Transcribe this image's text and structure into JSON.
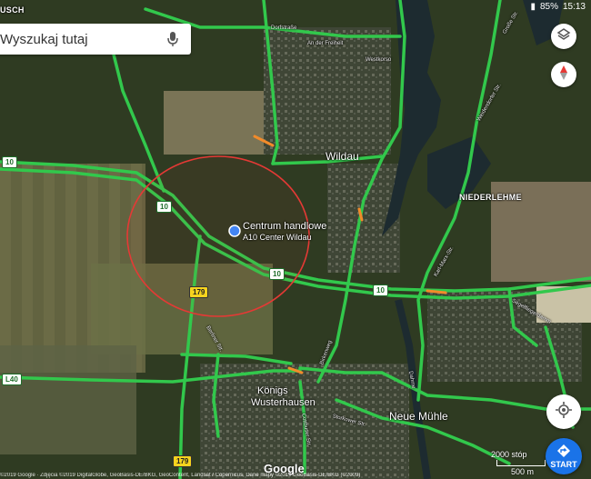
{
  "status": {
    "battery": "85%",
    "time": "15:13"
  },
  "search": {
    "placeholder": "Wyszukaj tutaj"
  },
  "corner_label": "USCH",
  "poi": {
    "name": "Centrum handlowe",
    "sub": "A10 Center Wildau"
  },
  "towns": {
    "wildau": "Wildau",
    "niederlehme": "NIEDERLEHME",
    "konigs1": "Königs",
    "konigs2": "Wusterhausen",
    "neue_muhle": "Neue Mühle"
  },
  "streets": [
    "Dorfstraße",
    "An der Freiheit",
    "Westkorso",
    "Berliner Str.",
    "Birkenweg",
    "Storkower Str.",
    "Cottbuser Str.",
    "Segelfliegerdamm",
    "Karl-Marx-Str.",
    "Dahme",
    "Weidendorfer Str.",
    "Große Str."
  ],
  "shields": {
    "a10_1": "10",
    "a10_2": "10",
    "a10_3": "10",
    "a10_4": "10",
    "b179_1": "179",
    "b179_2": "179",
    "l40": "L40"
  },
  "controls": {
    "start": "START"
  },
  "scale": {
    "ft": "2000 stóp",
    "m": "500 m"
  },
  "attribution": {
    "logo": "Google",
    "copyright": "©2019 Google · Zdjęcia ©2019 DigitalGlobe, GeoBasis-DE/BKG, GeoContent, Landsat / Copernicus, Dane mapy ©2019 GeoBasis-DE/BKG (©2009)"
  },
  "colors": {
    "traffic": "#32c84c",
    "radius": "#e53935",
    "start": "#1a73e8"
  }
}
